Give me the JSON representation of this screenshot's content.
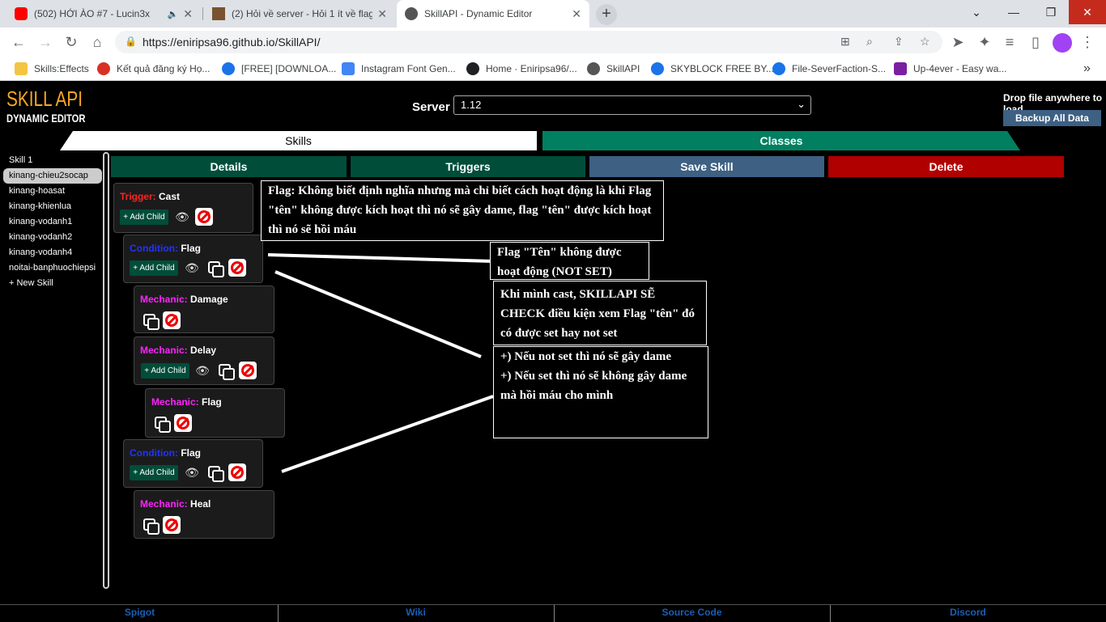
{
  "browser": {
    "tabs": [
      {
        "title": "(502) HỚI ÀO #7 - Lucin3x",
        "favicon_color": "#ff0000"
      },
      {
        "title": "(2) Hỏi về server - Hỏi 1 ít về flag",
        "favicon_color": "#7a5230"
      },
      {
        "title": "SkillAPI - Dynamic Editor",
        "favicon_color": "#555555"
      }
    ],
    "url": "https://eniripsa96.github.io/SkillAPI/",
    "bookmarks": [
      {
        "label": "Skills:Effects",
        "color": "#f4c542"
      },
      {
        "label": "Kết quả đăng ký Họ...",
        "color": "#d93025"
      },
      {
        "label": "[FREE] [DOWNLOA...",
        "color": "#1a73e8"
      },
      {
        "label": "Instagram Font Gen...",
        "color": "#4285f4"
      },
      {
        "label": "Home · Eniripsa96/...",
        "color": "#202124"
      },
      {
        "label": "SkillAPI",
        "color": "#555555"
      },
      {
        "label": "SKYBLOCK FREE BY...",
        "color": "#1a73e8"
      },
      {
        "label": "File-SeverFaction-S...",
        "color": "#1a73e8"
      },
      {
        "label": "Up-4ever - Easy wa...",
        "color": "#7b1fa2"
      }
    ]
  },
  "app": {
    "logo_line1": "SKILL API",
    "logo_line2": "DYNAMIC EDITOR",
    "server_label": "Server",
    "server_value": "1.12",
    "drop_text": "Drop file anywhere to load",
    "backup_label": "Backup All Data",
    "tab_skills": "Skills",
    "tab_classes": "Classes",
    "skills": [
      "Skill 1",
      "kinang-chieu2socap",
      "kinang-hoasat",
      "kinang-khienlua",
      "kinang-vodanh1",
      "kinang-vodanh2",
      "kinang-vodanh4",
      "noitai-banphuochiepsi",
      "+ New Skill"
    ],
    "actions": {
      "details": "Details",
      "triggers": "Triggers",
      "save": "Save Skill",
      "delete": "Delete"
    },
    "add_child": "+ Add Child",
    "nodes": [
      {
        "type": "Trigger:",
        "name": "Cast"
      },
      {
        "type": "Condition:",
        "name": "Flag"
      },
      {
        "type": "Mechanic:",
        "name": "Damage"
      },
      {
        "type": "Mechanic:",
        "name": "Delay"
      },
      {
        "type": "Mechanic:",
        "name": "Flag"
      },
      {
        "type": "Condition:",
        "name": "Flag"
      },
      {
        "type": "Mechanic:",
        "name": "Heal"
      }
    ],
    "footer": [
      "Spigot",
      "Wiki",
      "Source Code",
      "Discord"
    ]
  },
  "annotations": {
    "note1": "Flag: Không biết định nghĩa nhưng mà chỉ biết cách hoạt động là khi Flag \"tên\" không được kích hoạt thì nó sẽ gây dame, flag \"tên\" được kích hoạt thì nó sẽ hồi máu",
    "note2": "Flag \"Tên\" không được hoạt động (NOT SET)",
    "note3": "Khi mình cast, SKILLAPI SẼ CHECK điều kiện xem Flag \"tên\" đó có được set hay not set",
    "note4_line1": "+) Nếu not set thì nó sẽ gây dame",
    "note4_line2": "+) Nếu set thì nó sẽ không gây dame mà hồi máu cho mình"
  },
  "colors": {
    "logo": "#f5a623",
    "classes_tab": "#008060",
    "details_btn": "#004d3a",
    "save_btn": "#3d6083",
    "delete_btn": "#b00000",
    "trigger": "#ff2222",
    "condition": "#2233ff",
    "mechanic": "#ff22ff"
  }
}
